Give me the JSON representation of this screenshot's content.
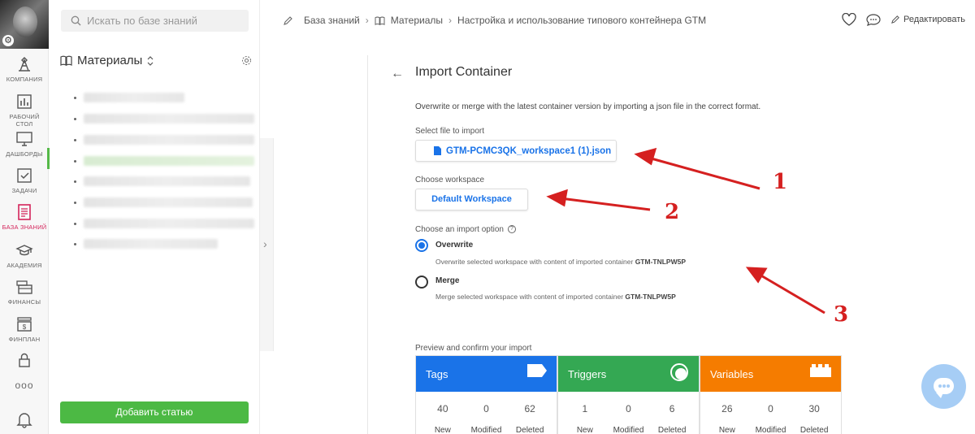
{
  "sidebar_rail": {
    "items": [
      {
        "label": "КОМПАНИЯ",
        "icon": "company-icon"
      },
      {
        "label": "РАБОЧИЙ СТОЛ",
        "icon": "desktop-chart-icon"
      },
      {
        "label": "ДАШБОРДЫ",
        "icon": "monitor-icon"
      },
      {
        "label": "ЗАДАЧИ",
        "icon": "checkbox-icon"
      },
      {
        "label": "БАЗА ЗНАНИЙ",
        "icon": "document-icon"
      },
      {
        "label": "АКАДЕМИЯ",
        "icon": "graduation-cap-icon"
      },
      {
        "label": "ФИНАНСЫ",
        "icon": "money-icon"
      },
      {
        "label": "ФИНПЛАН",
        "icon": "finplan-icon"
      }
    ],
    "active_color": "#d4245b",
    "active_bar_color": "#55b948",
    "more_label": "ooo"
  },
  "panel": {
    "search_placeholder": "Искать по базе знаний",
    "section_title": "Материалы",
    "add_button": "Добавить статью"
  },
  "breadcrumb": {
    "items": [
      "База знаний",
      "Материалы",
      "Настройка и использование типового контейнера GTM"
    ]
  },
  "top_actions": {
    "edit_label": "Редактировать"
  },
  "import": {
    "title": "Import Container",
    "description": "Overwrite or merge with the latest container version by importing a json file in the correct format.",
    "file_label": "Select file to import",
    "file_name": "GTM-PCMC3QK_workspace1 (1).json",
    "workspace_label": "Choose workspace",
    "workspace_button": "Default Workspace",
    "option_label": "Choose an import option",
    "options": [
      {
        "title": "Overwrite",
        "desc": "Overwrite selected workspace with content of imported container",
        "container": "GTM-TNLPW5P",
        "selected": true
      },
      {
        "title": "Merge",
        "desc": "Merge selected workspace with content of imported container",
        "container": "GTM-TNLPW5P",
        "selected": false
      }
    ],
    "preview_label": "Preview and confirm your import",
    "cards": [
      {
        "title": "Tags",
        "color": "#1a73e8",
        "new": "40",
        "modified": "0",
        "deleted": "62"
      },
      {
        "title": "Triggers",
        "color": "#34a853",
        "new": "1",
        "modified": "0",
        "deleted": "6"
      },
      {
        "title": "Variables",
        "color": "#f57c00",
        "new": "26",
        "modified": "0",
        "deleted": "30"
      }
    ],
    "col_labels": {
      "new": "New",
      "modified": "Modified",
      "deleted": "Deleted"
    }
  },
  "annotations": {
    "numbers": [
      "1",
      "2",
      "3"
    ],
    "color": "#d52020"
  }
}
